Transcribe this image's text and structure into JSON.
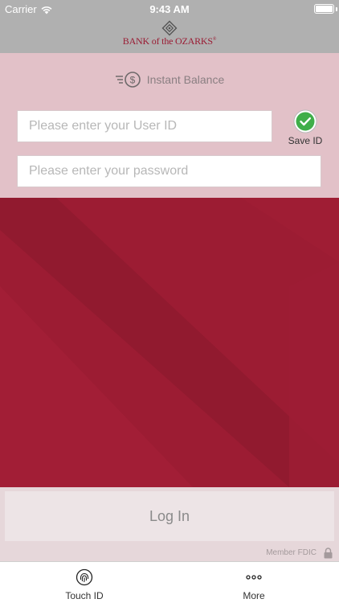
{
  "status_bar": {
    "carrier": "Carrier",
    "time": "9:43 AM",
    "battery_level": 1.0
  },
  "header": {
    "brand": "BANK of the OZARKS",
    "brand_mark": "®"
  },
  "instant_balance": {
    "label": "Instant Balance",
    "icon": "dollar-speed-icon"
  },
  "form": {
    "user_id_placeholder": "Please enter your User ID",
    "password_placeholder": "Please enter your password",
    "save_id_label": "Save ID",
    "save_id_checked": true
  },
  "login": {
    "button_label": "Log In"
  },
  "footer": {
    "fdic_label": "Member FDIC"
  },
  "tab_bar": {
    "items": [
      {
        "label": "Touch ID",
        "icon": "fingerprint-icon"
      },
      {
        "label": "More",
        "icon": "more-dots-icon"
      }
    ]
  },
  "colors": {
    "header_gray": "#b0b0b0",
    "login_pink": "#e2c1c8",
    "brand_crimson": "#9c1c33",
    "checkmark_green": "#3fae49"
  }
}
